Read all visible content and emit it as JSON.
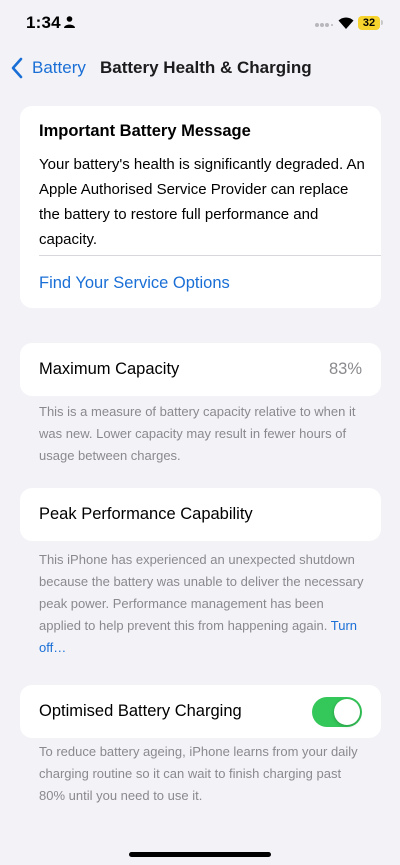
{
  "status_bar": {
    "time": "1:34",
    "battery_level": "32",
    "colors": {
      "battery_badge": "#f6d32d"
    }
  },
  "nav": {
    "back_label": "Battery",
    "title": "Battery Health & Charging"
  },
  "message_card": {
    "title": "Important Battery Message",
    "body": "Your battery's health is significantly degraded. An Apple Authorised Service Provider can replace the battery to restore full performance and capacity.",
    "link": "Find Your Service Options"
  },
  "max_capacity": {
    "label": "Maximum Capacity",
    "value": "83%",
    "footnote": "This is a measure of battery capacity relative to when it was new. Lower capacity may result in fewer hours of usage between charges."
  },
  "peak_performance": {
    "label": "Peak Performance Capability",
    "footnote": "This iPhone has experienced an unexpected shutdown because the battery was unable to deliver the necessary peak power. Performance management has been applied to help prevent this from happening again.",
    "footnote_link": "Turn off…"
  },
  "optimised_charging": {
    "label": "Optimised Battery Charging",
    "enabled": true,
    "footnote": "To reduce battery ageing, iPhone learns from your daily charging routine so it can wait to finish charging past 80% until you need to use it."
  },
  "colors": {
    "accent": "#1a6fd6",
    "toggle_on": "#34c759",
    "background": "#f2f2f7",
    "secondary_text": "#8a8a8e"
  },
  "icons": {
    "status": [
      "person-icon",
      "signal-icon",
      "wifi-icon"
    ],
    "nav": "chevron-left-icon"
  }
}
